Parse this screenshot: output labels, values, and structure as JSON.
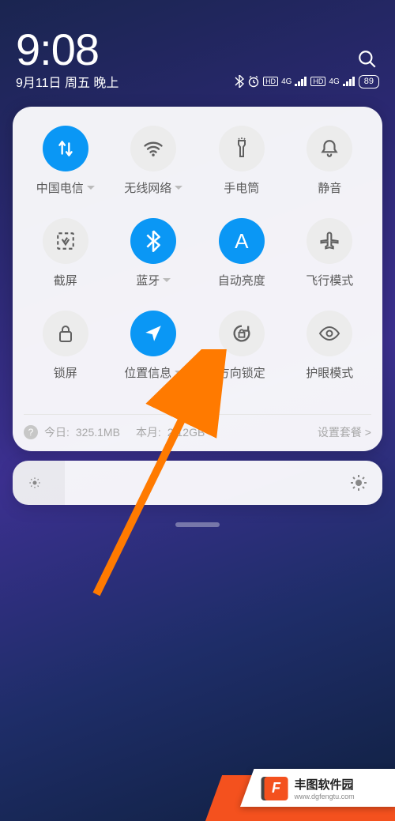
{
  "status": {
    "time": "9:08",
    "date": "9月11日 周五 晚上",
    "battery": "89"
  },
  "tiles": [
    {
      "label": "中国电信",
      "active": true,
      "icon": "data",
      "expand": true
    },
    {
      "label": "无线网络",
      "active": false,
      "icon": "wifi",
      "expand": true
    },
    {
      "label": "手电筒",
      "active": false,
      "icon": "flashlight",
      "expand": false
    },
    {
      "label": "静音",
      "active": false,
      "icon": "bell",
      "expand": false
    },
    {
      "label": "截屏",
      "active": false,
      "icon": "screenshot",
      "expand": false
    },
    {
      "label": "蓝牙",
      "active": true,
      "icon": "bluetooth",
      "expand": true
    },
    {
      "label": "自动亮度",
      "active": true,
      "icon": "letter-a",
      "expand": false
    },
    {
      "label": "飞行模式",
      "active": false,
      "icon": "airplane",
      "expand": false
    },
    {
      "label": "锁屏",
      "active": false,
      "icon": "lock",
      "expand": false
    },
    {
      "label": "位置信息",
      "active": true,
      "icon": "location",
      "expand": true
    },
    {
      "label": "方向锁定",
      "active": false,
      "icon": "rotation",
      "expand": false
    },
    {
      "label": "护眼模式",
      "active": false,
      "icon": "eye",
      "expand": false
    }
  ],
  "data_usage": {
    "today_label": "今日:",
    "today_value": "325.1MB",
    "month_label": "本月:",
    "month_value": "2.12GB",
    "plan_link": "设置套餐 >"
  },
  "watermark": {
    "title": "丰图软件园",
    "url": "www.dgfengtu.com"
  }
}
